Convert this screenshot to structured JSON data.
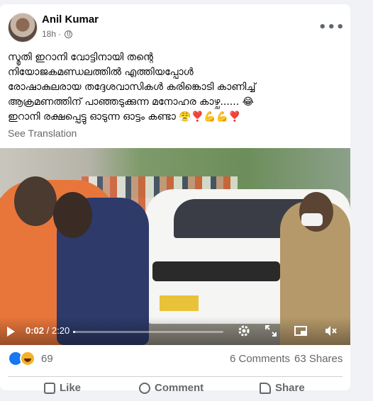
{
  "post": {
    "author": "Anil Kumar",
    "time": "18h",
    "more_label": "•••",
    "text_lines": [
      "സ്മൃതി ഇറാനി വോട്ടിനായി തന്റെ",
      "നിയോജകമണ്ഡലത്തിൽ എത്തിയപ്പോൾ",
      "രോഷാകുലരായ തദ്ദേശവാസികൾ കരിങ്കൊടി കാണിച്ച്",
      "ആക്രമണത്തിന് പാഞ്ഞടുക്കുന്ന മനോഹര കാഴ്ച...... 😂",
      "ഇറാനി രക്ഷപ്പെട്ടു ഓടുന്ന ഓട്ടം കണ്ടാ 😤❣️💪💪❣️"
    ],
    "see_translation": "See Translation"
  },
  "video": {
    "current_time": "0:02",
    "total_time": "2:20",
    "progress": 0.014
  },
  "stats": {
    "reaction_count": "69",
    "comments": "6 Comments",
    "shares": "63 Shares"
  },
  "actions": {
    "like": "Like",
    "comment": "Comment",
    "share": "Share"
  }
}
